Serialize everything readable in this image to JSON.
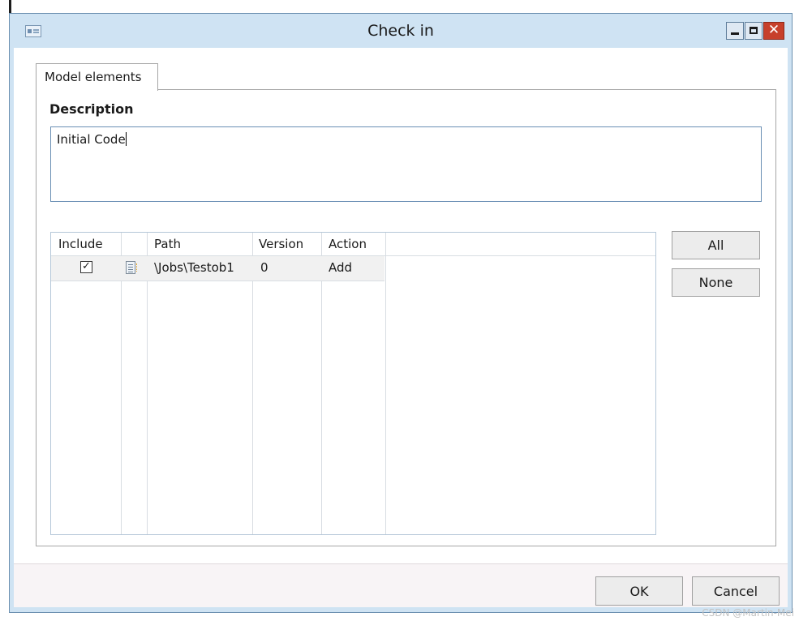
{
  "window": {
    "title": "Check in"
  },
  "tabs": [
    {
      "label": "Model elements"
    }
  ],
  "description": {
    "label": "Description",
    "value": "Initial Code"
  },
  "grid": {
    "columns": [
      "Include",
      "",
      "Path",
      "Version",
      "Action"
    ],
    "rows": [
      {
        "include": true,
        "icon": "document-icon",
        "path": "\\Jobs\\Testob1",
        "version": "0",
        "action": "Add"
      }
    ]
  },
  "side_buttons": {
    "all": "All",
    "none": "None"
  },
  "footer": {
    "ok": "OK",
    "cancel": "Cancel"
  },
  "watermark": "CSDN @Martin-Mei",
  "colors": {
    "titlebar": "#cfe3f3",
    "close_button": "#c7402b",
    "input_border": "#6a8fb4"
  }
}
